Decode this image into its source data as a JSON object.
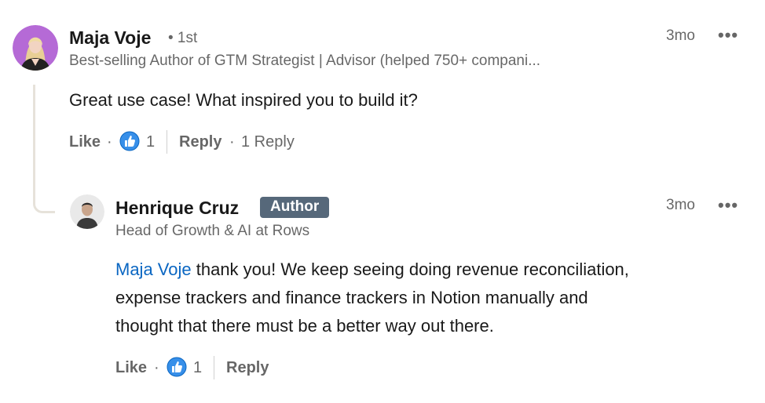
{
  "comment": {
    "author_name": "Maja Voje",
    "degree": "• 1st",
    "headline": "Best-selling Author of GTM Strategist | Advisor (helped 750+ compani...",
    "time": "3mo",
    "more_label": "•••",
    "text": "Great use case! What inspired you to build it?",
    "like_label": "Like",
    "dot": "·",
    "reaction_count": "1",
    "reply_label": "Reply",
    "replies_count": "1 Reply"
  },
  "reply": {
    "author_name": "Henrique Cruz",
    "badge": "Author",
    "headline": "Head of Growth & AI at Rows",
    "time": "3mo",
    "more_label": "•••",
    "mention": "Maja Voje",
    "text_line1": " thank you! We keep seeing doing revenue reconciliation,",
    "text_line2": "expense trackers and finance trackers in Notion manually and",
    "text_line3": "thought that there must be a better way out there.",
    "like_label": "Like",
    "dot": "·",
    "reaction_count": "1",
    "reply_label": "Reply"
  },
  "colors": {
    "link_blue": "#0a66c2",
    "like_blue": "#378fe9",
    "badge_bg": "#56687a",
    "thread_line": "#e6e2da"
  },
  "icons": {
    "reaction": "like-thumbs-up-icon",
    "more": "more-options-icon"
  }
}
